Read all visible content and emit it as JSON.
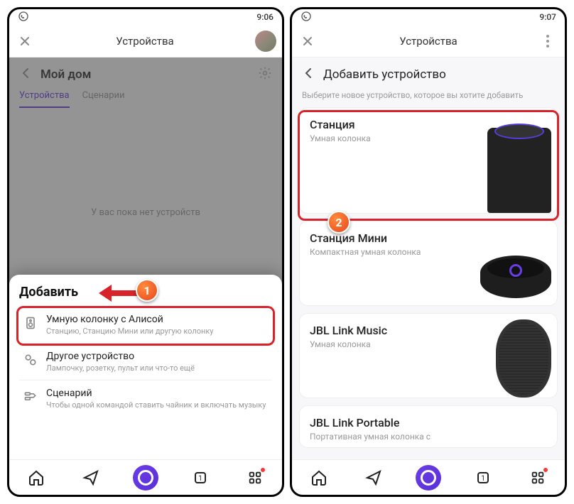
{
  "statusbar": {
    "time_left": "9:06",
    "time_right": "9:07"
  },
  "topbar": {
    "title": "Устройства"
  },
  "screen1": {
    "home_label": "Мой дом",
    "tabs": {
      "devices": "Устройства",
      "scenarios": "Сценарии"
    },
    "empty_text": "У вас пока нет устройств",
    "sheet": {
      "heading": "Добавить",
      "rows": [
        {
          "title": "Умную колонку с Алисой",
          "subtitle": "Станцию, Станцию Мини или другую колонку"
        },
        {
          "title": "Другое устройство",
          "subtitle": "Лампочку, розетку, пульт или что-то ещё"
        },
        {
          "title": "Сценарий",
          "subtitle": "Чтобы одной командой ставить чайник и включать музыку"
        }
      ]
    }
  },
  "screen2": {
    "title": "Добавить устройство",
    "hint": "Выберите новое устройство, которое вы хотите добавить",
    "devices": [
      {
        "title": "Станция",
        "subtitle": "Умная колонка"
      },
      {
        "title": "Станция Мини",
        "subtitle": "Компактная умная колонка"
      },
      {
        "title": "JBL Link Music",
        "subtitle": "Умная колонка"
      },
      {
        "title": "JBL Link Portable",
        "subtitle": "Портативная умная колонка с"
      }
    ]
  },
  "steps": {
    "one": "1",
    "two": "2"
  }
}
